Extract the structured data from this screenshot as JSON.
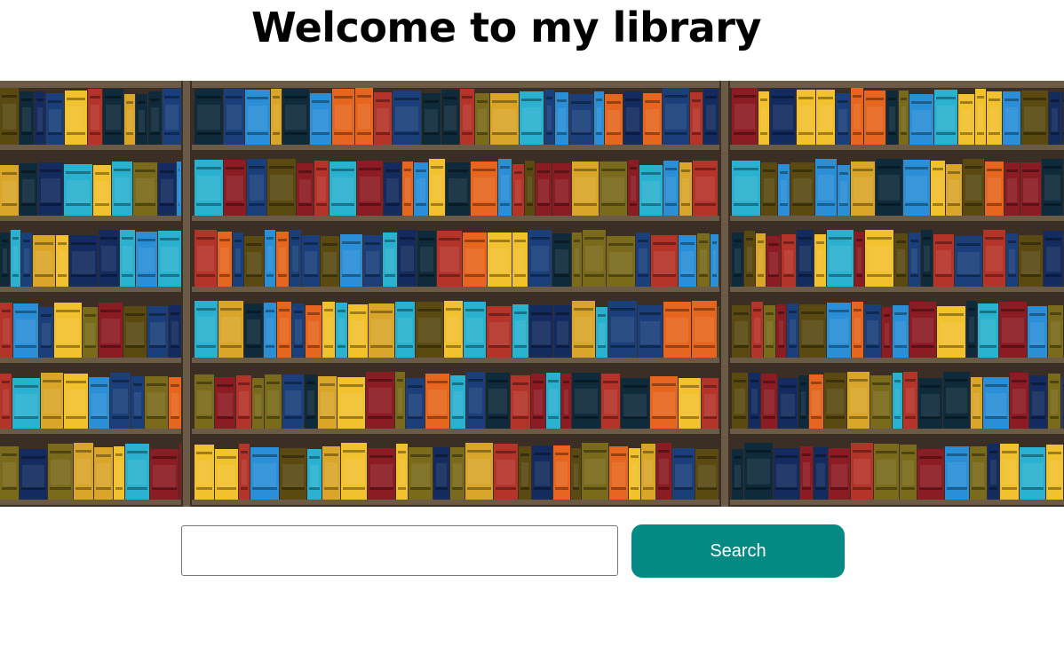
{
  "header": {
    "title": "Welcome to my library"
  },
  "banner": {
    "alt": "bookshelf",
    "shelf_rows": 6,
    "shelf_columns": 3,
    "colors": {
      "wood_dark": "#3b2f25",
      "wood_light": "#6b5a45",
      "book_palette": [
        "#f2c12e",
        "#e7661f",
        "#8c1c24",
        "#1a3f7a",
        "#2a8fd6",
        "#0f2a3a",
        "#5a4a12",
        "#2bb1d0",
        "#b5342a",
        "#7a6a1c",
        "#132b5e",
        "#d9a62a"
      ]
    }
  },
  "search": {
    "input_value": "",
    "input_placeholder": "",
    "button_label": "Search"
  },
  "colors": {
    "accent": "#028a83",
    "background": "#ffffff",
    "title_text": "#000000"
  }
}
